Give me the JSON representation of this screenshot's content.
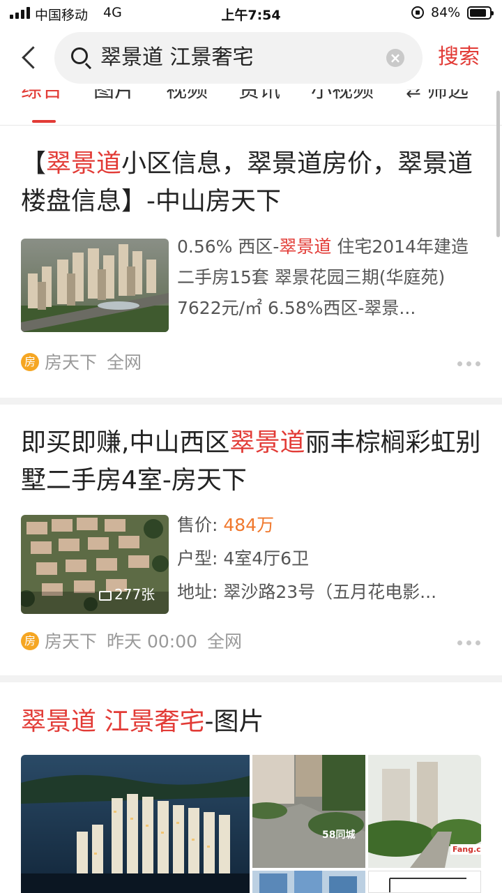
{
  "status_bar": {
    "carrier": "中国移动",
    "network": "4G",
    "time": "上午7:54",
    "battery": "84%",
    "battery_level": 0.84
  },
  "search": {
    "query": "翠景道 江景奢宅",
    "search_button": "搜索"
  },
  "tabs": [
    {
      "label": "综合",
      "active": true
    },
    {
      "label": "图片",
      "active": false
    },
    {
      "label": "视频",
      "active": false
    },
    {
      "label": "资讯",
      "active": false
    },
    {
      "label": "小视频",
      "active": false
    },
    {
      "label": "筛选",
      "active": false
    }
  ],
  "results": [
    {
      "title_parts": [
        "【",
        "翠景道",
        "小区信息，翠景道房价，翠景道楼盘信息】-中山房天下"
      ],
      "desc_parts": [
        "0.56% 西区-",
        "翠景道",
        " 住宅2014年建造 二手房15套 翠景花园三期(华庭苑) 7622元/㎡ 6.58%西区-翠景..."
      ],
      "source_badge": "房",
      "source": "房天下",
      "scope": "全网"
    },
    {
      "title_parts": [
        "即买即赚,中山西区",
        "翠景道",
        "丽丰棕榈彩虹别墅二手房4室-房天下"
      ],
      "photo_count": "277张",
      "price_label": "售价: ",
      "price": "484万",
      "layout": "户型: 4室4厅6卫",
      "address": "地址: 翠沙路23号（五月花电影...",
      "source_badge": "房",
      "source": "房天下",
      "time": "昨天 00:00",
      "scope": "全网"
    },
    {
      "title_parts": [
        "翠景道 江景奢宅",
        "-图片"
      ],
      "watermarks": [
        "58同城",
        "Fang.com"
      ]
    }
  ],
  "colors": {
    "accent": "#e23b36",
    "price": "#f0782d",
    "badge": "#f5a623"
  },
  "icons": [
    "back-arrow-icon",
    "search-icon",
    "clear-icon",
    "source-badge-icon",
    "more-icon",
    "photo-icon"
  ]
}
